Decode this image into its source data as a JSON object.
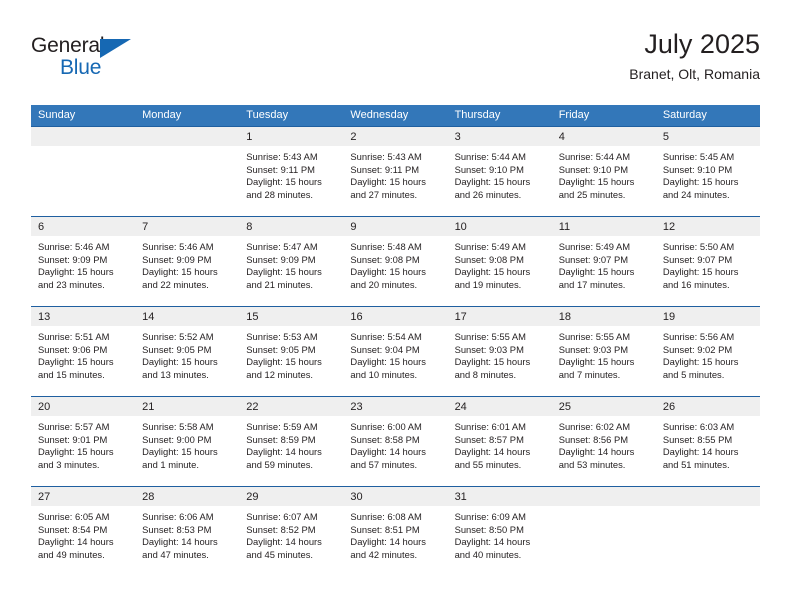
{
  "brand": {
    "name_top": "General",
    "name_bottom": "Blue",
    "triangle_icon": "triangle-icon",
    "color_blue": "#1668b3",
    "color_dark": "#231f20"
  },
  "header": {
    "title": "July 2025",
    "location": "Branet, Olt, Romania"
  },
  "theme": {
    "header_blue": "#3377b9",
    "week_rule": "#1f5fa0",
    "daynum_band": "#efefef",
    "text": "#231f20"
  },
  "weekday_headers": [
    "Sunday",
    "Monday",
    "Tuesday",
    "Wednesday",
    "Thursday",
    "Friday",
    "Saturday"
  ],
  "weeks": [
    [
      {
        "day": "",
        "sunrise": "",
        "sunset": "",
        "daylight_line1": "",
        "daylight_line2": ""
      },
      {
        "day": "",
        "sunrise": "",
        "sunset": "",
        "daylight_line1": "",
        "daylight_line2": ""
      },
      {
        "day": "1",
        "sunrise": "Sunrise: 5:43 AM",
        "sunset": "Sunset: 9:11 PM",
        "daylight_line1": "Daylight: 15 hours",
        "daylight_line2": "and 28 minutes."
      },
      {
        "day": "2",
        "sunrise": "Sunrise: 5:43 AM",
        "sunset": "Sunset: 9:11 PM",
        "daylight_line1": "Daylight: 15 hours",
        "daylight_line2": "and 27 minutes."
      },
      {
        "day": "3",
        "sunrise": "Sunrise: 5:44 AM",
        "sunset": "Sunset: 9:10 PM",
        "daylight_line1": "Daylight: 15 hours",
        "daylight_line2": "and 26 minutes."
      },
      {
        "day": "4",
        "sunrise": "Sunrise: 5:44 AM",
        "sunset": "Sunset: 9:10 PM",
        "daylight_line1": "Daylight: 15 hours",
        "daylight_line2": "and 25 minutes."
      },
      {
        "day": "5",
        "sunrise": "Sunrise: 5:45 AM",
        "sunset": "Sunset: 9:10 PM",
        "daylight_line1": "Daylight: 15 hours",
        "daylight_line2": "and 24 minutes."
      }
    ],
    [
      {
        "day": "6",
        "sunrise": "Sunrise: 5:46 AM",
        "sunset": "Sunset: 9:09 PM",
        "daylight_line1": "Daylight: 15 hours",
        "daylight_line2": "and 23 minutes."
      },
      {
        "day": "7",
        "sunrise": "Sunrise: 5:46 AM",
        "sunset": "Sunset: 9:09 PM",
        "daylight_line1": "Daylight: 15 hours",
        "daylight_line2": "and 22 minutes."
      },
      {
        "day": "8",
        "sunrise": "Sunrise: 5:47 AM",
        "sunset": "Sunset: 9:09 PM",
        "daylight_line1": "Daylight: 15 hours",
        "daylight_line2": "and 21 minutes."
      },
      {
        "day": "9",
        "sunrise": "Sunrise: 5:48 AM",
        "sunset": "Sunset: 9:08 PM",
        "daylight_line1": "Daylight: 15 hours",
        "daylight_line2": "and 20 minutes."
      },
      {
        "day": "10",
        "sunrise": "Sunrise: 5:49 AM",
        "sunset": "Sunset: 9:08 PM",
        "daylight_line1": "Daylight: 15 hours",
        "daylight_line2": "and 19 minutes."
      },
      {
        "day": "11",
        "sunrise": "Sunrise: 5:49 AM",
        "sunset": "Sunset: 9:07 PM",
        "daylight_line1": "Daylight: 15 hours",
        "daylight_line2": "and 17 minutes."
      },
      {
        "day": "12",
        "sunrise": "Sunrise: 5:50 AM",
        "sunset": "Sunset: 9:07 PM",
        "daylight_line1": "Daylight: 15 hours",
        "daylight_line2": "and 16 minutes."
      }
    ],
    [
      {
        "day": "13",
        "sunrise": "Sunrise: 5:51 AM",
        "sunset": "Sunset: 9:06 PM",
        "daylight_line1": "Daylight: 15 hours",
        "daylight_line2": "and 15 minutes."
      },
      {
        "day": "14",
        "sunrise": "Sunrise: 5:52 AM",
        "sunset": "Sunset: 9:05 PM",
        "daylight_line1": "Daylight: 15 hours",
        "daylight_line2": "and 13 minutes."
      },
      {
        "day": "15",
        "sunrise": "Sunrise: 5:53 AM",
        "sunset": "Sunset: 9:05 PM",
        "daylight_line1": "Daylight: 15 hours",
        "daylight_line2": "and 12 minutes."
      },
      {
        "day": "16",
        "sunrise": "Sunrise: 5:54 AM",
        "sunset": "Sunset: 9:04 PM",
        "daylight_line1": "Daylight: 15 hours",
        "daylight_line2": "and 10 minutes."
      },
      {
        "day": "17",
        "sunrise": "Sunrise: 5:55 AM",
        "sunset": "Sunset: 9:03 PM",
        "daylight_line1": "Daylight: 15 hours",
        "daylight_line2": "and 8 minutes."
      },
      {
        "day": "18",
        "sunrise": "Sunrise: 5:55 AM",
        "sunset": "Sunset: 9:03 PM",
        "daylight_line1": "Daylight: 15 hours",
        "daylight_line2": "and 7 minutes."
      },
      {
        "day": "19",
        "sunrise": "Sunrise: 5:56 AM",
        "sunset": "Sunset: 9:02 PM",
        "daylight_line1": "Daylight: 15 hours",
        "daylight_line2": "and 5 minutes."
      }
    ],
    [
      {
        "day": "20",
        "sunrise": "Sunrise: 5:57 AM",
        "sunset": "Sunset: 9:01 PM",
        "daylight_line1": "Daylight: 15 hours",
        "daylight_line2": "and 3 minutes."
      },
      {
        "day": "21",
        "sunrise": "Sunrise: 5:58 AM",
        "sunset": "Sunset: 9:00 PM",
        "daylight_line1": "Daylight: 15 hours",
        "daylight_line2": "and 1 minute."
      },
      {
        "day": "22",
        "sunrise": "Sunrise: 5:59 AM",
        "sunset": "Sunset: 8:59 PM",
        "daylight_line1": "Daylight: 14 hours",
        "daylight_line2": "and 59 minutes."
      },
      {
        "day": "23",
        "sunrise": "Sunrise: 6:00 AM",
        "sunset": "Sunset: 8:58 PM",
        "daylight_line1": "Daylight: 14 hours",
        "daylight_line2": "and 57 minutes."
      },
      {
        "day": "24",
        "sunrise": "Sunrise: 6:01 AM",
        "sunset": "Sunset: 8:57 PM",
        "daylight_line1": "Daylight: 14 hours",
        "daylight_line2": "and 55 minutes."
      },
      {
        "day": "25",
        "sunrise": "Sunrise: 6:02 AM",
        "sunset": "Sunset: 8:56 PM",
        "daylight_line1": "Daylight: 14 hours",
        "daylight_line2": "and 53 minutes."
      },
      {
        "day": "26",
        "sunrise": "Sunrise: 6:03 AM",
        "sunset": "Sunset: 8:55 PM",
        "daylight_line1": "Daylight: 14 hours",
        "daylight_line2": "and 51 minutes."
      }
    ],
    [
      {
        "day": "27",
        "sunrise": "Sunrise: 6:05 AM",
        "sunset": "Sunset: 8:54 PM",
        "daylight_line1": "Daylight: 14 hours",
        "daylight_line2": "and 49 minutes."
      },
      {
        "day": "28",
        "sunrise": "Sunrise: 6:06 AM",
        "sunset": "Sunset: 8:53 PM",
        "daylight_line1": "Daylight: 14 hours",
        "daylight_line2": "and 47 minutes."
      },
      {
        "day": "29",
        "sunrise": "Sunrise: 6:07 AM",
        "sunset": "Sunset: 8:52 PM",
        "daylight_line1": "Daylight: 14 hours",
        "daylight_line2": "and 45 minutes."
      },
      {
        "day": "30",
        "sunrise": "Sunrise: 6:08 AM",
        "sunset": "Sunset: 8:51 PM",
        "daylight_line1": "Daylight: 14 hours",
        "daylight_line2": "and 42 minutes."
      },
      {
        "day": "31",
        "sunrise": "Sunrise: 6:09 AM",
        "sunset": "Sunset: 8:50 PM",
        "daylight_line1": "Daylight: 14 hours",
        "daylight_line2": "and 40 minutes."
      },
      {
        "day": "",
        "sunrise": "",
        "sunset": "",
        "daylight_line1": "",
        "daylight_line2": ""
      },
      {
        "day": "",
        "sunrise": "",
        "sunset": "",
        "daylight_line1": "",
        "daylight_line2": ""
      }
    ]
  ]
}
